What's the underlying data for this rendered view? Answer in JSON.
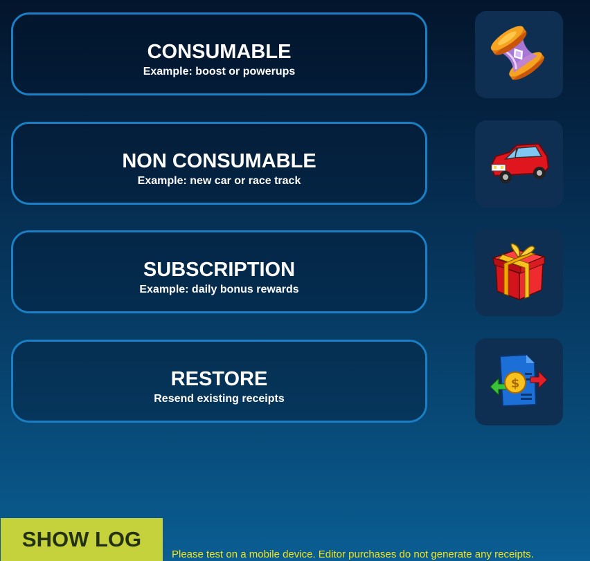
{
  "options": [
    {
      "title": "CONSUMABLE",
      "subtitle": "Example: boost or powerups",
      "icon": "hourglass-icon"
    },
    {
      "title": "NON CONSUMABLE",
      "subtitle": "Example: new car or race track",
      "icon": "car-icon"
    },
    {
      "title": "SUBSCRIPTION",
      "subtitle": "Example: daily bonus rewards",
      "icon": "gift-icon"
    },
    {
      "title": "RESTORE",
      "subtitle": "Resend existing receipts",
      "icon": "receipt-exchange-icon"
    }
  ],
  "log_button": {
    "label": "SHOW LOG"
  },
  "notice": "Please test on a mobile device. Editor purchases do not generate any receipts.",
  "colors": {
    "button_border": "#1a7fc4",
    "tile_background": "#0e2f52",
    "log_button": "#c6d23b",
    "notice_text": "#f2e51d"
  }
}
